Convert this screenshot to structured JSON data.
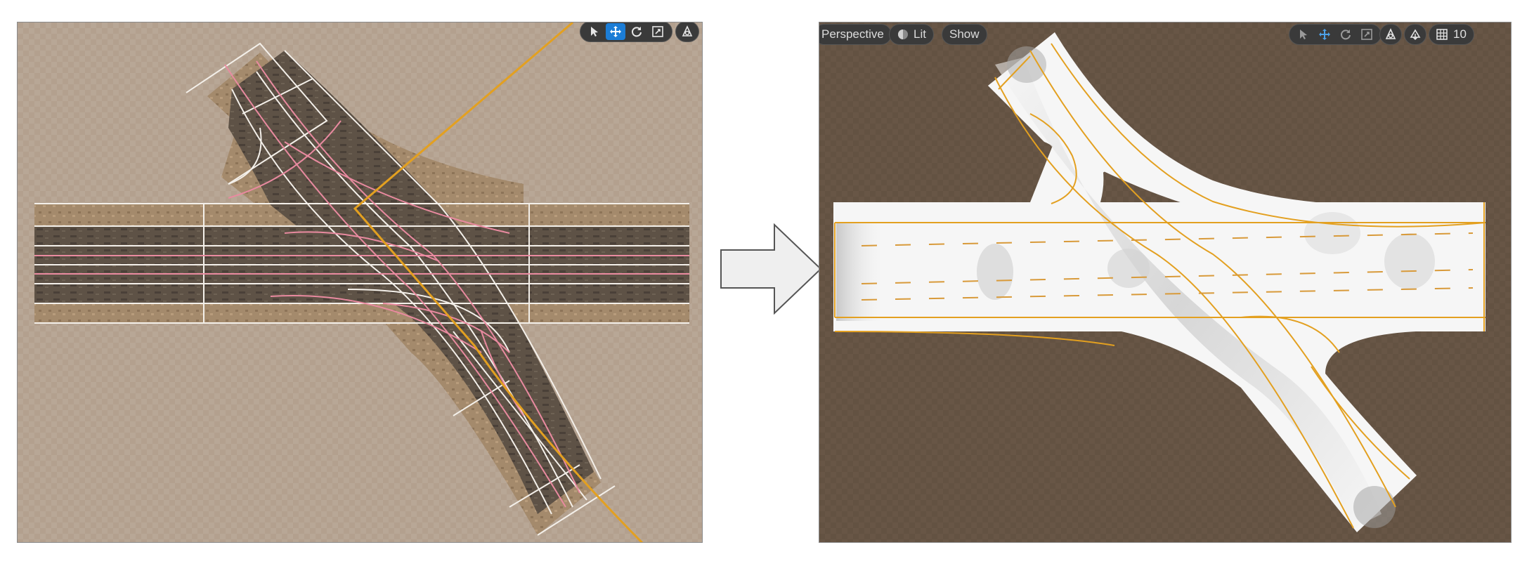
{
  "left_viewport": {
    "toolbar": {
      "tools": [
        {
          "name": "select-icon",
          "active": false
        },
        {
          "name": "move-icon",
          "active": true
        },
        {
          "name": "rotate-icon",
          "active": false
        },
        {
          "name": "scale-icon",
          "active": false
        }
      ],
      "camera_speed_icon": "camera-speed-icon"
    }
  },
  "right_viewport": {
    "toolbar": {
      "perspective_label": "Perspective",
      "lit_label": "Lit",
      "show_label": "Show",
      "grid_snap_value": "10"
    }
  },
  "colors": {
    "left_ground": "#b3a08e",
    "right_ground": "#685646",
    "selection_orange": "#e3a020",
    "road_asphalt": "#5e5246",
    "lane_pink": "#e98aa0",
    "road_preview_white": "#f6f6f6",
    "toolbar_active": "#1c7dd6"
  },
  "transition_arrow_icon": "right-arrow-icon"
}
